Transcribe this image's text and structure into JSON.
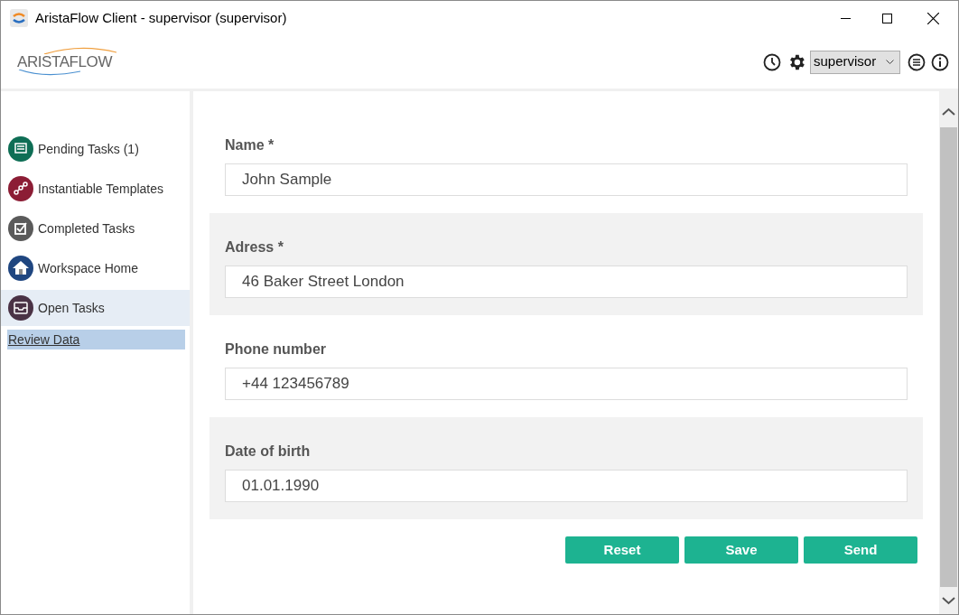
{
  "window": {
    "title": "AristaFlow Client - supervisor (supervisor)"
  },
  "logo": {
    "text": "ARISTAFLOW"
  },
  "header": {
    "user_select": {
      "value": "supervisor"
    }
  },
  "sidebar": {
    "items": [
      {
        "label": "Pending Tasks (1)",
        "color": "#0e6e55",
        "kind": "inbox",
        "selected": false
      },
      {
        "label": "Instantiable Templates",
        "color": "#8c1d35",
        "kind": "nodes",
        "selected": false
      },
      {
        "label": "Completed Tasks",
        "color": "#5a5a5a",
        "kind": "check",
        "selected": false
      },
      {
        "label": "Workspace Home",
        "color": "#1f4680",
        "kind": "home",
        "selected": false
      },
      {
        "label": "Open Tasks",
        "color": "#4a3245",
        "kind": "tray",
        "selected": true,
        "children": [
          {
            "label": "Review Data",
            "selected": true
          }
        ]
      }
    ]
  },
  "form": {
    "fields": [
      {
        "label": "Name *",
        "value": "John Sample"
      },
      {
        "label": "Adress *",
        "value": "46 Baker Street London"
      },
      {
        "label": "Phone number",
        "value": "+44 123456789"
      },
      {
        "label": "Date of birth",
        "value": "01.01.1990"
      }
    ],
    "buttons": [
      "Reset",
      "Save",
      "Send"
    ]
  }
}
